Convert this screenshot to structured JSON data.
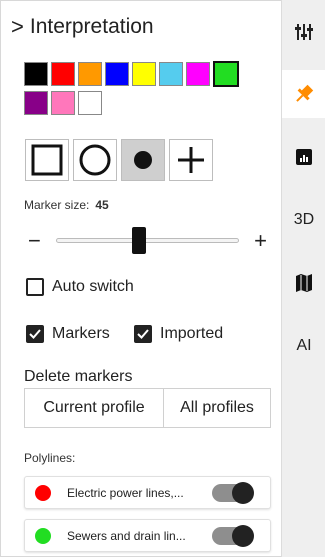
{
  "panel": {
    "title": "Interpretation",
    "colors": [
      {
        "hex": "#000000",
        "selected": false
      },
      {
        "hex": "#ff0000",
        "selected": false
      },
      {
        "hex": "#ff9900",
        "selected": false
      },
      {
        "hex": "#0000ff",
        "selected": false
      },
      {
        "hex": "#ffff00",
        "selected": false
      },
      {
        "hex": "#55ccee",
        "selected": false
      },
      {
        "hex": "#ff00ff",
        "selected": false
      },
      {
        "hex": "#22dd22",
        "selected": true
      },
      {
        "hex": "#880088",
        "selected": false
      },
      {
        "hex": "#ff77bb",
        "selected": false
      },
      {
        "hex": "#ffffff",
        "selected": false
      }
    ],
    "shapes": [
      {
        "icon": "square-outline-icon",
        "active": false
      },
      {
        "icon": "circle-outline-icon",
        "active": false
      },
      {
        "icon": "filled-dot-icon",
        "active": true
      },
      {
        "icon": "plus-icon",
        "active": false
      }
    ],
    "marker_size": {
      "label": "Marker size:",
      "value": "45",
      "fraction": 0.45
    },
    "auto_switch": {
      "label": "Auto switch",
      "checked": false
    },
    "markers": {
      "label": "Markers",
      "checked": true
    },
    "imported": {
      "label": "Imported",
      "checked": true
    },
    "delete_markers": {
      "label": "Delete markers",
      "current_profile": "Current profile",
      "all_profiles": "All profiles"
    },
    "polylines": {
      "label": "Polylines:",
      "items": [
        {
          "name": "Electric power lines,...",
          "color": "#ff0000",
          "on": true
        },
        {
          "name": "Sewers and drain lin...",
          "color": "#22dd22",
          "on": true
        }
      ]
    }
  },
  "rail": {
    "items": [
      {
        "icon": "sliders-icon",
        "active": false
      },
      {
        "icon": "pin-icon",
        "active": true,
        "color": "#ff8c00"
      },
      {
        "icon": "chart-icon",
        "active": false
      },
      {
        "label": "3D"
      },
      {
        "icon": "map-icon",
        "active": false
      },
      {
        "label": "AI"
      }
    ]
  }
}
